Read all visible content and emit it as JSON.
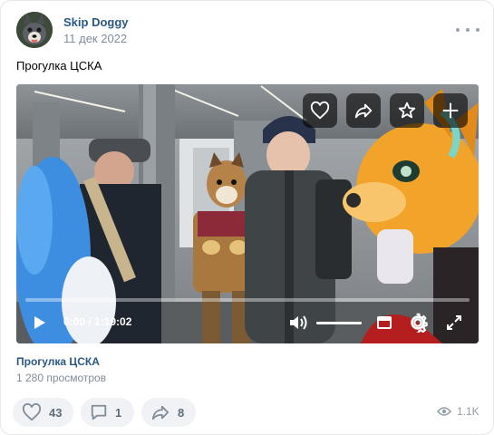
{
  "post": {
    "author": "Skip Doggy",
    "date": "11 дек 2022",
    "text": "Прогулка ЦСКА"
  },
  "video": {
    "time": "0:00 / 1:19:02",
    "progress": 0,
    "volume": 1.0,
    "title": "Прогулка ЦСКА",
    "views": "1 280 просмотров"
  },
  "actions": {
    "likes": "43",
    "comments": "1",
    "shares": "8",
    "views": "1.1K"
  },
  "colors": {
    "link": "#2a5885",
    "secondary": "#818c99",
    "pill_bg": "#f0f2f5"
  }
}
